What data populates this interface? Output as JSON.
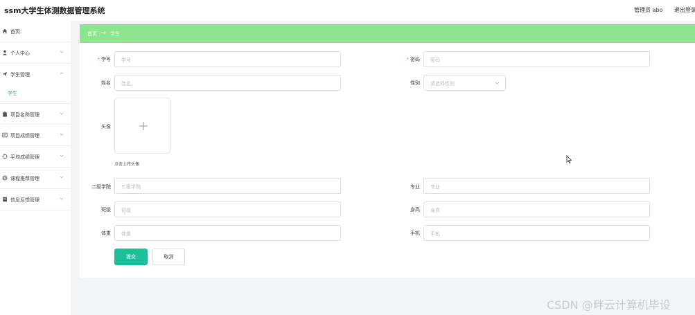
{
  "header": {
    "app_title": "ssm大学生体测数据管理系统",
    "user_label": "管理员 abo",
    "logout_label": "退出登录"
  },
  "sidebar": {
    "items": [
      {
        "label": "首页",
        "icon": "home-icon"
      },
      {
        "label": "个人中心",
        "icon": "user-icon"
      },
      {
        "label": "学生管理",
        "icon": "send-icon"
      },
      {
        "label": "项目名称管理",
        "icon": "clipboard-icon"
      },
      {
        "label": "项目成绩管理",
        "icon": "document-icon"
      },
      {
        "label": "平均成绩管理",
        "icon": "crosshair-icon"
      },
      {
        "label": "课程推荐管理",
        "icon": "globe-icon"
      },
      {
        "label": "信息反馈管理",
        "icon": "inbox-icon"
      }
    ],
    "active_sub_item": "学生"
  },
  "breadcrumb": {
    "home": "首页",
    "separator": "→",
    "current": "学生"
  },
  "form": {
    "student_id": {
      "label": "学号",
      "placeholder": "学号",
      "required": true
    },
    "password": {
      "label": "密码",
      "placeholder": "密码",
      "required": true
    },
    "name": {
      "label": "姓名",
      "placeholder": "姓名"
    },
    "gender": {
      "label": "性别",
      "placeholder": "请选择性别"
    },
    "avatar": {
      "label": "头像",
      "hint": "点击上传头像"
    },
    "college": {
      "label": "二级学院",
      "placeholder": "二级学院"
    },
    "major": {
      "label": "专业",
      "placeholder": "专业"
    },
    "class": {
      "label": "班级",
      "placeholder": "班级"
    },
    "height": {
      "label": "身高",
      "placeholder": "身高"
    },
    "weight": {
      "label": "体重",
      "placeholder": "体重"
    },
    "phone": {
      "label": "手机",
      "placeholder": "手机"
    },
    "submit_label": "提交",
    "cancel_label": "取消"
  },
  "colors": {
    "breadcrumb_bg": "#8fe58f",
    "primary": "#1cbf97",
    "active_menu": "#2ab39c",
    "required_star": "#f56c6c"
  },
  "watermark": "CSDN @畔云计算机毕设"
}
